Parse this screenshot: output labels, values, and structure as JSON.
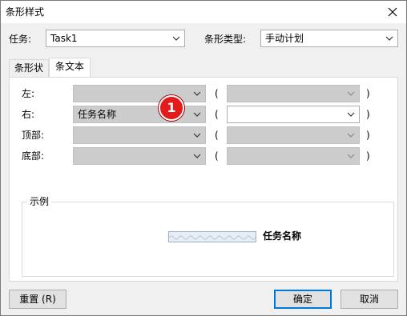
{
  "window": {
    "title": "条形样式"
  },
  "task": {
    "label": "任务:",
    "value": "Task1"
  },
  "bar_type": {
    "label": "条形类型:",
    "value": "手动计划"
  },
  "tabs": [
    {
      "label": "条形状",
      "active": false
    },
    {
      "label": "条文本",
      "active": true
    }
  ],
  "text_rows": [
    {
      "label": "左:",
      "field_value": "",
      "paren_open": "(",
      "paren_close": ")"
    },
    {
      "label": "右:",
      "field_value": "任务名称",
      "paren_open": "(",
      "paren_close": ")"
    },
    {
      "label": "顶部:",
      "field_value": "",
      "paren_open": "(",
      "paren_close": ")"
    },
    {
      "label": "底部:",
      "field_value": "",
      "paren_open": "(",
      "paren_close": ")"
    }
  ],
  "sample": {
    "title": "示例",
    "text": "任务名称"
  },
  "annotation": {
    "badge": "1"
  },
  "buttons": {
    "reset": "重置 (R)",
    "ok": "确定",
    "cancel": "取消"
  },
  "icons": {
    "close": "close-icon",
    "dropdown": "chevron-down-icon"
  },
  "colors": {
    "badge": "#e31b1b",
    "focus": "#0078d7",
    "sample_bar": "#e7edf5"
  }
}
